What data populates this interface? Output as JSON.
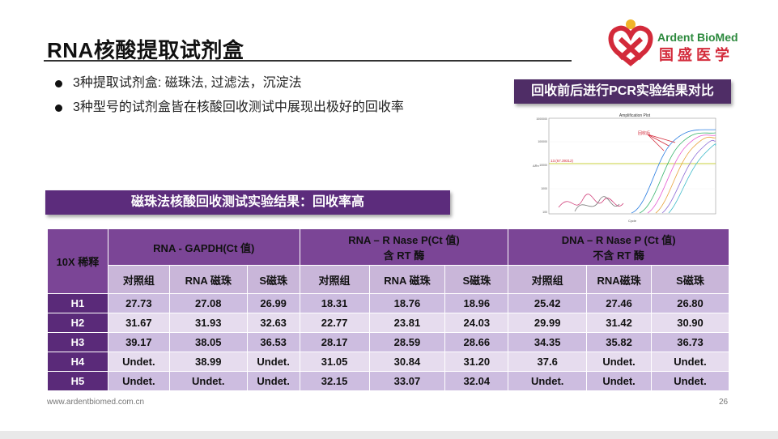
{
  "slide": {
    "title": "RNA核酸提取试剂盒",
    "page_number": "26",
    "footer_url": "www.ardentbiomed.com.cn"
  },
  "logo": {
    "english": "Ardent BioMed",
    "chinese": "国盛医学"
  },
  "bullets": [
    "3种提取试剂盒: 磁珠法, 过滤法，沉淀法",
    "3种型号的试剂盒皆在核酸回收测试中展现出极好的回收率"
  ],
  "pcr_panel": {
    "label": "回收前后进行PCR实验结果对比",
    "chart_title": "Amplification Plot",
    "chart_annotation": "回收后",
    "threshold_label": "13.(67.39312)",
    "x_axis_label": "Cycle",
    "y_axis_label": "ΔRn"
  },
  "banner": "磁珠法核酸回收测试实验结果：回收率高",
  "table": {
    "corner_label": "10X 稀释",
    "groups": [
      {
        "line1": "RNA - GAPDH(Ct 值)",
        "line2": ""
      },
      {
        "line1": "RNA – R Nase P(Ct 值)",
        "line2": "含 RT 酶"
      },
      {
        "line1": "DNA – R Nase P (Ct 值)",
        "line2": "不含 RT 酶"
      }
    ],
    "subheaders": [
      "对照组",
      "RNA 磁珠",
      "S磁珠",
      "对照组",
      "RNA 磁珠",
      "S磁珠",
      "对照组",
      "RNA磁珠",
      "S磁珠"
    ],
    "rows": [
      {
        "label": "H1",
        "values": [
          "27.73",
          "27.08",
          "26.99",
          "18.31",
          "18.76",
          "18.96",
          "25.42",
          "27.46",
          "26.80"
        ]
      },
      {
        "label": "H2",
        "values": [
          "31.67",
          "31.93",
          "32.63",
          "22.77",
          "23.81",
          "24.03",
          "29.99",
          "31.42",
          "30.90"
        ]
      },
      {
        "label": "H3",
        "values": [
          "39.17",
          "38.05",
          "36.53",
          "28.17",
          "28.59",
          "28.66",
          "34.35",
          "35.82",
          "36.73"
        ]
      },
      {
        "label": "H4",
        "values": [
          "Undet.",
          "38.99",
          "Undet.",
          "31.05",
          "30.84",
          "31.20",
          "37.6",
          "Undet.",
          "Undet."
        ]
      },
      {
        "label": "H5",
        "values": [
          "Undet.",
          "Undet.",
          "Undet.",
          "32.15",
          "33.07",
          "32.04",
          "Undet.",
          "Undet.",
          "Undet."
        ]
      }
    ]
  },
  "colors": {
    "banner": "#5c2c7c",
    "table_header": "#7b4596",
    "row_light": "#e6dcee",
    "row_dark": "#cdbde0",
    "logo_green": "#2d8a3e",
    "logo_red": "#d32a3a"
  }
}
